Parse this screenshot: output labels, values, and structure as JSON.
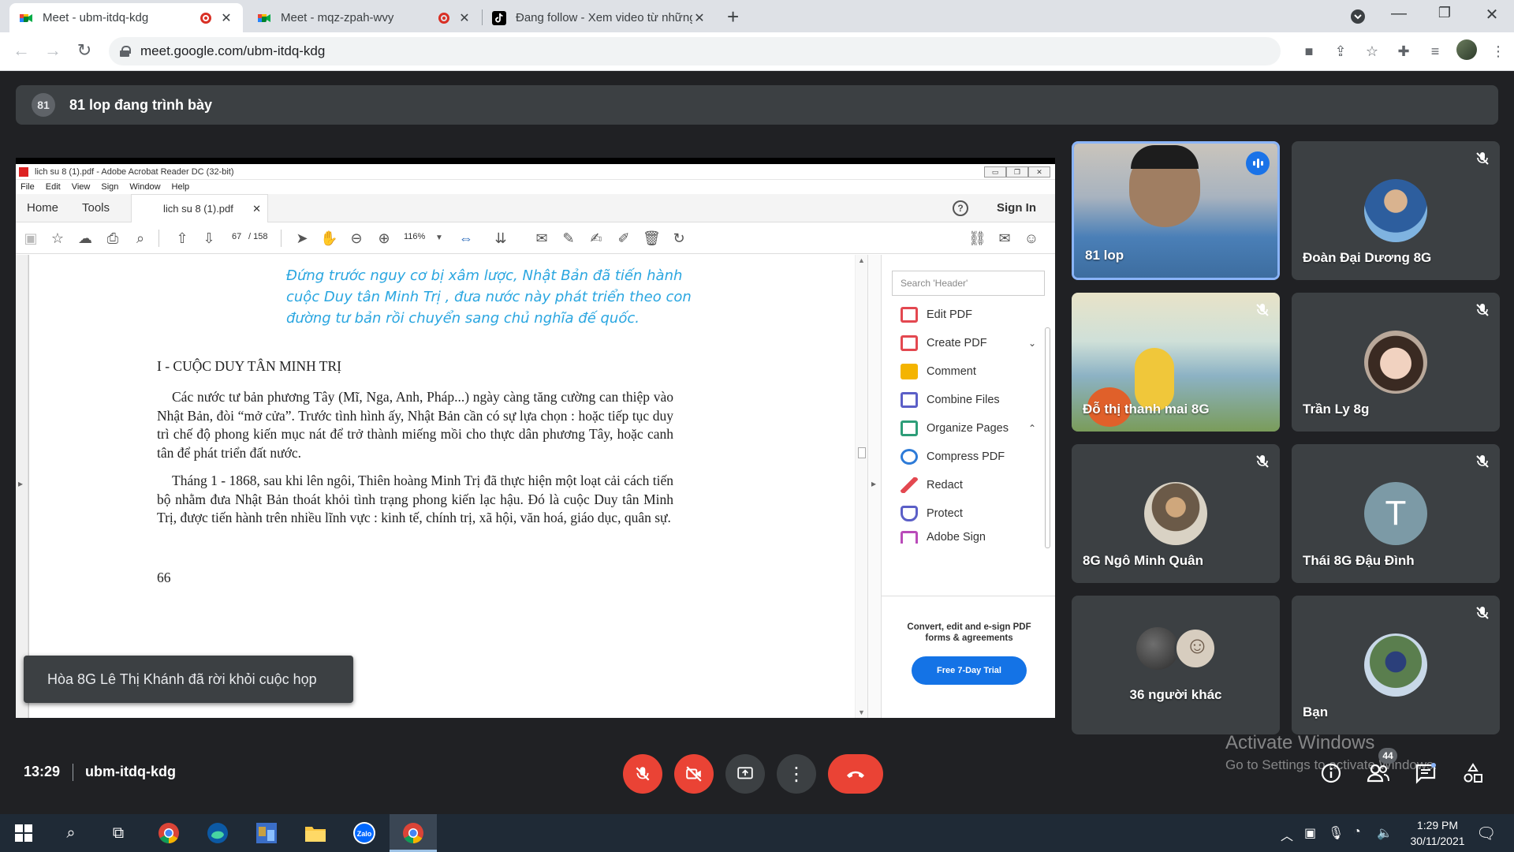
{
  "browser": {
    "tabs": [
      {
        "title": "Meet - ubm-itdq-kdg",
        "active": true,
        "recording": true
      },
      {
        "title": "Meet - mqz-zpah-wvy",
        "active": false,
        "recording": true
      },
      {
        "title": "Đang follow - Xem video từ những",
        "active": false,
        "recording": false
      }
    ],
    "new_tab": "+",
    "url": "meet.google.com/ubm-itdq-kdg"
  },
  "meet": {
    "presenter_badge": "81",
    "presenter_text": "81 lop đang trình bày",
    "clock": "13:29",
    "meeting_code": "ubm-itdq-kdg",
    "participants_count": "44",
    "toast": "Hòa 8G Lê Thị Khánh đã rời khỏi cuộc họp",
    "tiles": [
      {
        "name": "81 lop",
        "type": "video-speaking"
      },
      {
        "name": "Đoàn Đại Dương 8G",
        "type": "avatar"
      },
      {
        "name": "Đỗ thị thanh mai 8G",
        "type": "video-muted"
      },
      {
        "name": "Trần Ly 8g",
        "type": "avatar"
      },
      {
        "name": "8G Ngô Minh Quân",
        "type": "avatar"
      },
      {
        "name": "Thái 8G Đậu Đình",
        "type": "letter",
        "letter": "T"
      },
      {
        "name": "36 người khác",
        "type": "others"
      },
      {
        "name": "Bạn",
        "type": "avatar"
      }
    ],
    "activate_windows": {
      "title": "Activate Windows",
      "subtitle": "Go to Settings to activate Windows."
    }
  },
  "acrobat": {
    "window_title": "lich su 8 (1).pdf - Adobe Acrobat Reader DC (32-bit)",
    "menu": [
      "File",
      "Edit",
      "View",
      "Sign",
      "Window",
      "Help"
    ],
    "tabs": {
      "home": "Home",
      "tools": "Tools",
      "document": "lich su 8 (1).pdf"
    },
    "sign_in": "Sign In",
    "help": "?",
    "page_current": "67",
    "page_total": "/ 158",
    "zoom": "116%",
    "search_placeholder": "Search 'Header'",
    "tools_panel": [
      {
        "label": "Edit PDF",
        "color": "#e34850"
      },
      {
        "label": "Create PDF",
        "color": "#e34850",
        "chevron": "⌄"
      },
      {
        "label": "Comment",
        "color": "#f4b400"
      },
      {
        "label": "Combine Files",
        "color": "#5b5fc7"
      },
      {
        "label": "Organize Pages",
        "color": "#2d9d78",
        "chevron": "⌃"
      },
      {
        "label": "Compress PDF",
        "color": "#2d7bd8"
      },
      {
        "label": "Redact",
        "color": "#e34850"
      },
      {
        "label": "Protect",
        "color": "#5b5fc7"
      },
      {
        "label": "Adobe Sign",
        "color": "#b94bb9"
      }
    ],
    "promo_text": "Convert, edit and e-sign PDF forms & agreements",
    "promo_button": "Free 7-Day Trial"
  },
  "document": {
    "intro": "Đứng trước nguy cơ bị xâm lược, Nhật Bản đã tiến hành cuộc Duy tân Minh Trị , đưa nước này phát triển theo con đường tư bản rồi chuyển sang chủ nghĩa đế quốc.",
    "heading": "I - CUỘC DUY TÂN MINH TRỊ",
    "paragraph1": "Các nước tư bản phương Tây (Mĩ, Nga, Anh, Pháp...) ngày càng tăng cường can thiệp vào Nhật Bản, đòi “mở cửa”. Trước tình hình ấy, Nhật Bản cần có sự lựa chọn : hoặc tiếp tục duy trì chế độ phong kiến mục nát để trở thành miếng mồi cho thực dân phương Tây, hoặc canh tân để phát triển đất nước.",
    "paragraph2": "Tháng 1 - 1868, sau khi lên ngôi, Thiên hoàng Minh Trị đã thực hiện một loạt cải cách tiến bộ nhằm đưa Nhật Bản thoát khỏi tình trạng phong kiến lạc hậu. Đó là cuộc Duy tân Minh Trị, được tiến hành trên nhiều lĩnh vực : kinh tế, chính trị, xã hội, văn hoá, giáo dục, quân sự.",
    "page_number": "66"
  },
  "taskbar": {
    "time": "1:29 PM",
    "date": "30/11/2021",
    "zalo_label": "Zalo"
  },
  "colors": {
    "meet_bg": "#202124",
    "tile_bg": "#3c4043",
    "red": "#ea4335",
    "speaking_blue": "#1a73e8",
    "doc_intro_blue": "#2aa6e0"
  }
}
